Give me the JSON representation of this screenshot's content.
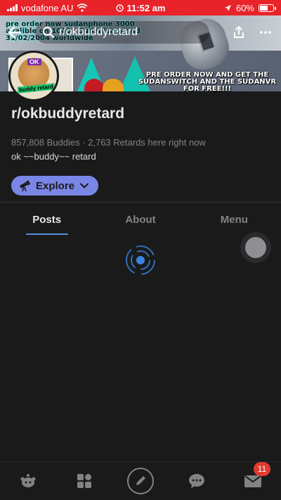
{
  "status": {
    "carrier": "vodafone AU",
    "time": "11:52 am",
    "battery": "60%",
    "accent": "#e8232a"
  },
  "banner": {
    "promo_top": "pre order now sudanphone 3000 avalible on 1000 . Sudanistan and 31/02/2004 worldwide",
    "promo_bottom": "PRE ORDER NOW AND GET THE SUDANSWITCH AND THE SUDANVR FOR FREE!!!",
    "avatar_badge": "OK",
    "avatar_caption": "buddy retard"
  },
  "nav": {
    "search_text": "r/okbuddyretard",
    "back_icon": "arrow-left-icon",
    "share_icon": "share-icon",
    "more_icon": "more-icon"
  },
  "subreddit": {
    "name": "r/okbuddyretard",
    "stats": "857,808 Buddies · 2,763 Retards here right now",
    "description": "ok ~~buddy~~ retard",
    "explore_label": "Explore"
  },
  "tabs": [
    {
      "label": "Posts",
      "active": true
    },
    {
      "label": "About",
      "active": false
    },
    {
      "label": "Menu",
      "active": false
    }
  ],
  "bottom_nav": {
    "items": [
      "home-icon",
      "communities-icon",
      "create-post-icon",
      "chat-icon",
      "inbox-icon"
    ],
    "inbox_badge": "11"
  }
}
